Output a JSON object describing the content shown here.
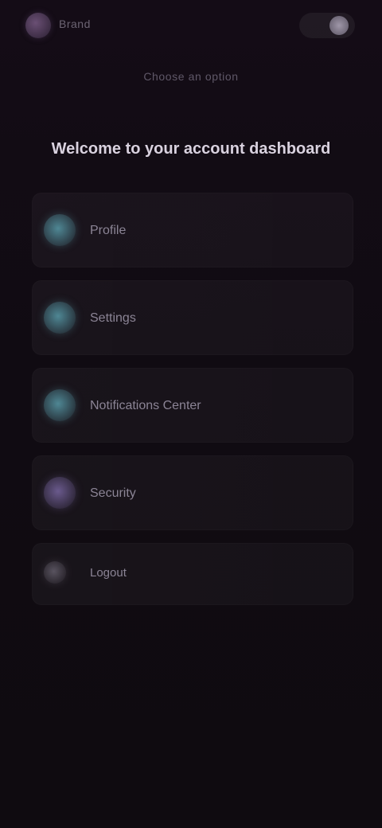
{
  "topbar": {
    "brand": "Brand",
    "menu_icon": "user-icon"
  },
  "subtitle": "Choose an option",
  "headline": "Welcome to your account dashboard",
  "options": [
    {
      "label": "Profile",
      "icon": "circle-icon",
      "color": "#4f8794"
    },
    {
      "label": "Settings",
      "icon": "circle-icon",
      "color": "#4f8794"
    },
    {
      "label": "Notifications Center",
      "icon": "circle-icon",
      "color": "#4f8794"
    },
    {
      "label": "Security",
      "icon": "circle-icon",
      "color": "#6a5a8d"
    },
    {
      "label": "Logout",
      "icon": "circle-icon",
      "color": "#6f6977"
    }
  ]
}
